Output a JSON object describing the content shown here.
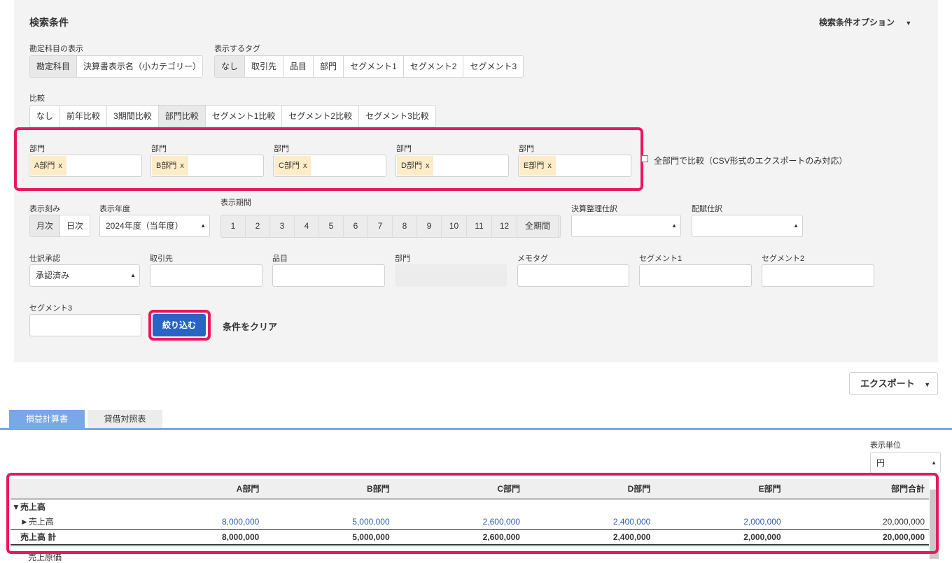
{
  "search": {
    "title": "検索条件",
    "options_label": "検索条件オプション",
    "account_display": {
      "label": "勘定科目の表示",
      "options": [
        "勘定科目",
        "決算書表示名（小カテゴリー）"
      ]
    },
    "tag_display": {
      "label": "表示するタグ",
      "options": [
        "なし",
        "取引先",
        "品目",
        "部門",
        "セグメント1",
        "セグメント2",
        "セグメント3"
      ]
    },
    "compare": {
      "label": "比較",
      "options": [
        "なし",
        "前年比較",
        "3期間比較",
        "部門比較",
        "セグメント1比較",
        "セグメント2比較",
        "セグメント3比較"
      ]
    },
    "departments": {
      "field_label": "部門",
      "chips": [
        "A部門",
        "B部門",
        "C部門",
        "D部門",
        "E部門"
      ],
      "remove_glyph": "x",
      "all_compare_label": "全部門で比較（CSV形式のエクスポートのみ対応）"
    },
    "display_unit_cols": {
      "label": "表示刻み",
      "options": [
        "月次",
        "日次"
      ]
    },
    "fiscal_year": {
      "label": "表示年度",
      "value": "2024年度（当年度）"
    },
    "period": {
      "label": "表示期間",
      "months": [
        "1",
        "2",
        "3",
        "4",
        "5",
        "6",
        "7",
        "8",
        "9",
        "10",
        "11",
        "12"
      ],
      "all_label": "全期間"
    },
    "closing_entries": {
      "label": "決算整理仕訳",
      "value": ""
    },
    "allocation_entries": {
      "label": "配賦仕訳",
      "value": ""
    },
    "approval": {
      "label": "仕訳承認",
      "value": "承認済み"
    },
    "partner": {
      "label": "取引先"
    },
    "item": {
      "label": "品目"
    },
    "department": {
      "label": "部門"
    },
    "memo_tag": {
      "label": "メモタグ"
    },
    "segment1": {
      "label": "セグメント1"
    },
    "segment2": {
      "label": "セグメント2"
    },
    "segment3": {
      "label": "セグメント3"
    },
    "filter_button": "絞り込む",
    "clear_button": "条件をクリア"
  },
  "export_button": "エクスポート",
  "tabs": [
    "損益計算書",
    "貸借対照表"
  ],
  "unit": {
    "label": "表示単位",
    "value": "円"
  },
  "report": {
    "columns": [
      "A部門",
      "B部門",
      "C部門",
      "D部門",
      "E部門",
      "部門合計"
    ],
    "group_label": "▼売上高",
    "rows": [
      {
        "name": "►売上高",
        "values": [
          "8,000,000",
          "5,000,000",
          "2,600,000",
          "2,400,000",
          "2,000,000",
          "20,000,000"
        ]
      }
    ],
    "total": {
      "name": "売上高 計",
      "values": [
        "8,000,000",
        "5,000,000",
        "2,600,000",
        "2,400,000",
        "2,000,000",
        "20,000,000"
      ]
    },
    "next_label": "売上原価"
  }
}
